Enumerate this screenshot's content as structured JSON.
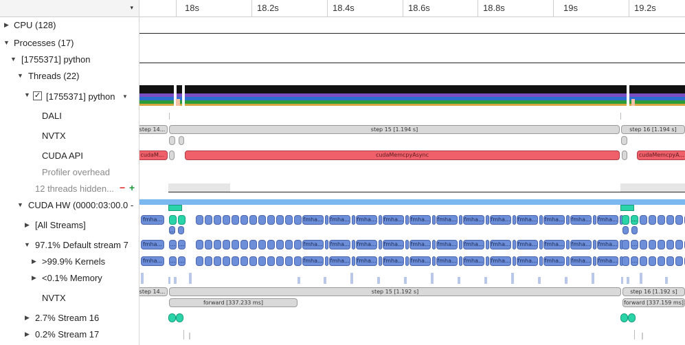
{
  "header": {
    "dropdown_icon": "chevron-down-icon"
  },
  "ruler": {
    "labels": [
      "18s",
      "18.2s",
      "18.4s",
      "18.6s",
      "18.8s",
      "19s",
      "19.2s"
    ]
  },
  "tree": {
    "cpu": "CPU (128)",
    "processes": "Processes (17)",
    "process": "[1755371] python",
    "threads": "Threads (22)",
    "thread": "[1755371] python",
    "dali": "DALI",
    "nvtx": "NVTX",
    "cuda_api": "CUDA API",
    "profiler_overhead": "Profiler overhead",
    "hidden": "12 threads hidden...",
    "cuda_hw": "CUDA HW (0000:03:00.0 -",
    "all_streams": "[All Streams]",
    "default_stream": "97.1% Default stream 7",
    "kernels": ">99.9% Kernels",
    "memory": "<0.1% Memory",
    "nvtx2": "NVTX",
    "stream16": "2.7% Stream 16",
    "stream17": "0.2% Stream 17"
  },
  "tracks": {
    "nvtx_thread": {
      "left": "step 14...",
      "main": "step 15 [1.194 s]",
      "right": "step 16 [1.194 s]"
    },
    "cuda_api": {
      "left": "cudaM...",
      "main": "cudaMemcpyAsync",
      "right": "cudaMemcpyA..."
    },
    "kernel_label": "fmha...",
    "kernel_small": "...",
    "nvtx_gpu": {
      "left": "step 14...",
      "main": "step 15 [1.192 s]",
      "right": "step 16 [1.192 s]"
    },
    "forward": {
      "main": "forward [337.233 ms]",
      "right": "forward [337.159 ms]"
    }
  },
  "colors": {
    "cuda_api": "#f0606a",
    "kernel": "#6d8ed8",
    "stream16": "#2bd3a8",
    "nvtx": "#d9d9d9",
    "memory": "#7bb8ef"
  }
}
